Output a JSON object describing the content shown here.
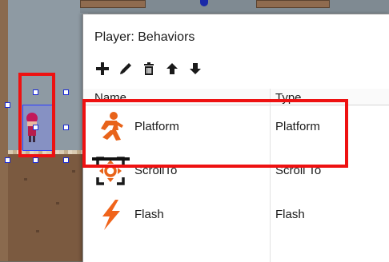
{
  "dialog": {
    "title": "Player: Behaviors",
    "toolbar": [
      {
        "icon": "add-icon",
        "label": "Add behavior"
      },
      {
        "icon": "edit-icon",
        "label": "Edit behavior"
      },
      {
        "icon": "delete-icon",
        "label": "Delete behavior"
      },
      {
        "icon": "move-up-icon",
        "label": "Move up"
      },
      {
        "icon": "move-down-icon",
        "label": "Move down"
      }
    ],
    "columns": {
      "name": "Name",
      "type": "Type"
    },
    "rows": [
      {
        "name": "Platform",
        "type": "Platform",
        "icon": "platform-runner-icon",
        "icon_color": "#e8631a"
      },
      {
        "name": "ScrollTo",
        "type": "Scroll To",
        "icon": "scroll-to-icon",
        "icon_color": "#e8631a"
      },
      {
        "name": "Flash",
        "type": "Flash",
        "icon": "flash-lightning-icon",
        "icon_color": "#f0641b"
      }
    ]
  },
  "colors": {
    "highlight": "#ee1111",
    "selection": "#2b3cff",
    "icon_accent": "#e8631a"
  }
}
